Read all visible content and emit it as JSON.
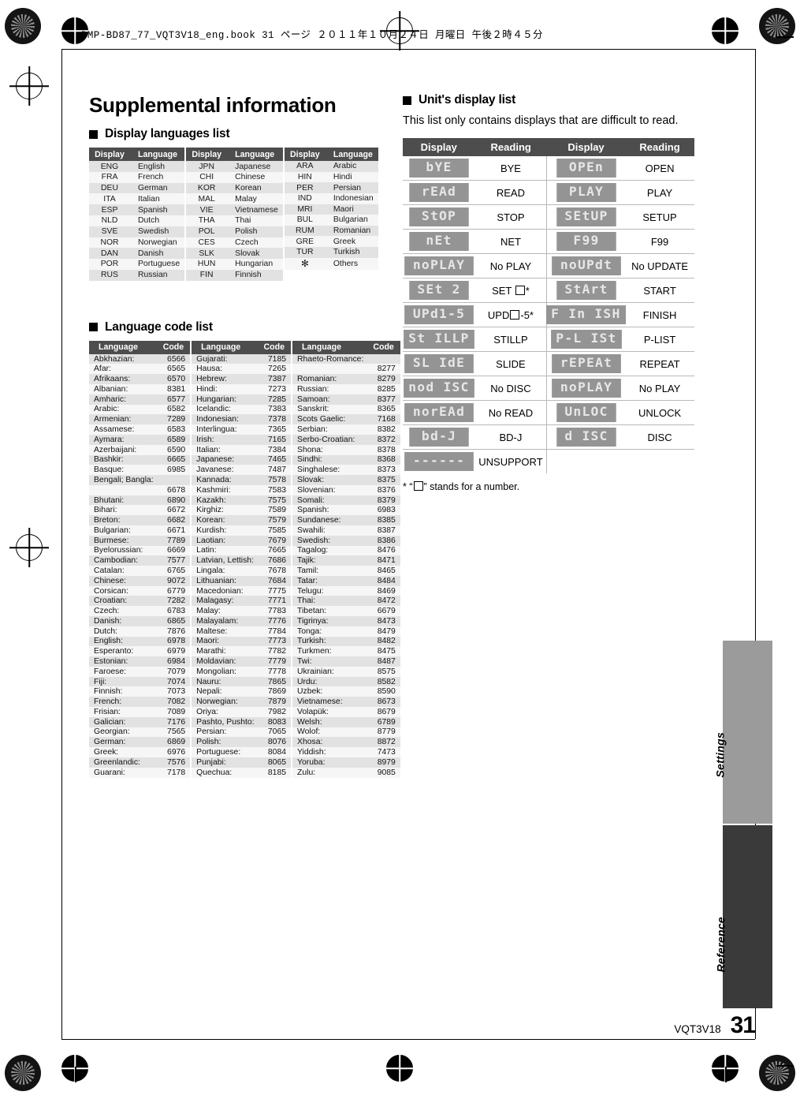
{
  "doc_header": "DMP-BD87_77_VQT3V18_eng.book  31 ページ  ２０１１年１０月２４日  月曜日  午後２時４５分",
  "title": "Supplemental information",
  "sections": {
    "display_languages": "Display languages list",
    "language_code": "Language code list",
    "unit_display": "Unit's display list"
  },
  "unit_display_lead": "This list only contains displays that are difficult to read.",
  "lang_list": {
    "headers": [
      "Display",
      "Language"
    ],
    "blocks": [
      [
        [
          "ENG",
          "English"
        ],
        [
          "FRA",
          "French"
        ],
        [
          "DEU",
          "German"
        ],
        [
          "ITA",
          "Italian"
        ],
        [
          "ESP",
          "Spanish"
        ],
        [
          "NLD",
          "Dutch"
        ],
        [
          "SVE",
          "Swedish"
        ],
        [
          "NOR",
          "Norwegian"
        ],
        [
          "DAN",
          "Danish"
        ],
        [
          "POR",
          "Portuguese"
        ],
        [
          "RUS",
          "Russian"
        ]
      ],
      [
        [
          "JPN",
          "Japanese"
        ],
        [
          "CHI",
          "Chinese"
        ],
        [
          "KOR",
          "Korean"
        ],
        [
          "MAL",
          "Malay"
        ],
        [
          "VIE",
          "Vietnamese"
        ],
        [
          "THA",
          "Thai"
        ],
        [
          "POL",
          "Polish"
        ],
        [
          "CES",
          "Czech"
        ],
        [
          "SLK",
          "Slovak"
        ],
        [
          "HUN",
          "Hungarian"
        ],
        [
          "FIN",
          "Finnish"
        ]
      ],
      [
        [
          "ARA",
          "Arabic"
        ],
        [
          "HIN",
          "Hindi"
        ],
        [
          "PER",
          "Persian"
        ],
        [
          "IND",
          "Indonesian"
        ],
        [
          "MRI",
          "Maori"
        ],
        [
          "BUL",
          "Bulgarian"
        ],
        [
          "RUM",
          "Romanian"
        ],
        [
          "GRE",
          "Greek"
        ],
        [
          "TUR",
          "Turkish"
        ],
        [
          "✻",
          "Others"
        ]
      ]
    ]
  },
  "code_list": {
    "headers": [
      "Language",
      "Code"
    ],
    "columns": [
      [
        [
          "Abkhazian:",
          "6566"
        ],
        [
          "Afar:",
          "6565"
        ],
        [
          "Afrikaans:",
          "6570"
        ],
        [
          "Albanian:",
          "8381"
        ],
        [
          "Amharic:",
          "6577"
        ],
        [
          "Arabic:",
          "6582"
        ],
        [
          "Armenian:",
          "7289"
        ],
        [
          "Assamese:",
          "6583"
        ],
        [
          "Aymara:",
          "6589"
        ],
        [
          "Azerbaijani:",
          "6590"
        ],
        [
          "Bashkir:",
          "6665"
        ],
        [
          "Basque:",
          "6985"
        ],
        [
          "Bengali; Bangla:",
          ""
        ],
        [
          "",
          "6678"
        ],
        [
          "Bhutani:",
          "6890"
        ],
        [
          "Bihari:",
          "6672"
        ],
        [
          "Breton:",
          "6682"
        ],
        [
          "Bulgarian:",
          "6671"
        ],
        [
          "Burmese:",
          "7789"
        ],
        [
          "Byelorussian:",
          "6669"
        ],
        [
          "Cambodian:",
          "7577"
        ],
        [
          "Catalan:",
          "6765"
        ],
        [
          "Chinese:",
          "9072"
        ],
        [
          "Corsican:",
          "6779"
        ],
        [
          "Croatian:",
          "7282"
        ],
        [
          "Czech:",
          "6783"
        ],
        [
          "Danish:",
          "6865"
        ],
        [
          "Dutch:",
          "7876"
        ],
        [
          "English:",
          "6978"
        ],
        [
          "Esperanto:",
          "6979"
        ],
        [
          "Estonian:",
          "6984"
        ],
        [
          "Faroese:",
          "7079"
        ],
        [
          "Fiji:",
          "7074"
        ],
        [
          "Finnish:",
          "7073"
        ],
        [
          "French:",
          "7082"
        ],
        [
          "Frisian:",
          "7089"
        ],
        [
          "Galician:",
          "7176"
        ],
        [
          "Georgian:",
          "7565"
        ],
        [
          "German:",
          "6869"
        ],
        [
          "Greek:",
          "6976"
        ],
        [
          "Greenlandic:",
          "7576"
        ],
        [
          "Guarani:",
          "7178"
        ]
      ],
      [
        [
          "Gujarati:",
          "7185"
        ],
        [
          "Hausa:",
          "7265"
        ],
        [
          "Hebrew:",
          "7387"
        ],
        [
          "Hindi:",
          "7273"
        ],
        [
          "Hungarian:",
          "7285"
        ],
        [
          "Icelandic:",
          "7383"
        ],
        [
          "Indonesian:",
          "7378"
        ],
        [
          "Interlingua:",
          "7365"
        ],
        [
          "Irish:",
          "7165"
        ],
        [
          "Italian:",
          "7384"
        ],
        [
          "Japanese:",
          "7465"
        ],
        [
          "Javanese:",
          "7487"
        ],
        [
          "Kannada:",
          "7578"
        ],
        [
          "Kashmiri:",
          "7583"
        ],
        [
          "Kazakh:",
          "7575"
        ],
        [
          "Kirghiz:",
          "7589"
        ],
        [
          "Korean:",
          "7579"
        ],
        [
          "Kurdish:",
          "7585"
        ],
        [
          "Laotian:",
          "7679"
        ],
        [
          "Latin:",
          "7665"
        ],
        [
          "Latvian, Lettish:",
          "7686"
        ],
        [
          "Lingala:",
          "7678"
        ],
        [
          "Lithuanian:",
          "7684"
        ],
        [
          "Macedonian:",
          "7775"
        ],
        [
          "Malagasy:",
          "7771"
        ],
        [
          "Malay:",
          "7783"
        ],
        [
          "Malayalam:",
          "7776"
        ],
        [
          "Maltese:",
          "7784"
        ],
        [
          "Maori:",
          "7773"
        ],
        [
          "Marathi:",
          "7782"
        ],
        [
          "Moldavian:",
          "7779"
        ],
        [
          "Mongolian:",
          "7778"
        ],
        [
          "Nauru:",
          "7865"
        ],
        [
          "Nepali:",
          "7869"
        ],
        [
          "Norwegian:",
          "7879"
        ],
        [
          "Oriya:",
          "7982"
        ],
        [
          "Pashto, Pushto:",
          "8083"
        ],
        [
          "Persian:",
          "7065"
        ],
        [
          "Polish:",
          "8076"
        ],
        [
          "Portuguese:",
          "8084"
        ],
        [
          "Punjabi:",
          "8065"
        ],
        [
          "Quechua:",
          "8185"
        ]
      ],
      [
        [
          "Rhaeto-Romance:",
          ""
        ],
        [
          "",
          "8277"
        ],
        [
          "Romanian:",
          "8279"
        ],
        [
          "Russian:",
          "8285"
        ],
        [
          "Samoan:",
          "8377"
        ],
        [
          "Sanskrit:",
          "8365"
        ],
        [
          "Scots Gaelic:",
          "7168"
        ],
        [
          "Serbian:",
          "8382"
        ],
        [
          "Serbo-Croatian:",
          "8372"
        ],
        [
          "Shona:",
          "8378"
        ],
        [
          "Sindhi:",
          "8368"
        ],
        [
          "Singhalese:",
          "8373"
        ],
        [
          "Slovak:",
          "8375"
        ],
        [
          "Slovenian:",
          "8376"
        ],
        [
          "Somali:",
          "8379"
        ],
        [
          "Spanish:",
          "6983"
        ],
        [
          "Sundanese:",
          "8385"
        ],
        [
          "Swahili:",
          "8387"
        ],
        [
          "Swedish:",
          "8386"
        ],
        [
          "Tagalog:",
          "8476"
        ],
        [
          "Tajik:",
          "8471"
        ],
        [
          "Tamil:",
          "8465"
        ],
        [
          "Tatar:",
          "8484"
        ],
        [
          "Telugu:",
          "8469"
        ],
        [
          "Thai:",
          "8472"
        ],
        [
          "Tibetan:",
          "6679"
        ],
        [
          "Tigrinya:",
          "8473"
        ],
        [
          "Tonga:",
          "8479"
        ],
        [
          "Turkish:",
          "8482"
        ],
        [
          "Turkmen:",
          "8475"
        ],
        [
          "Twi:",
          "8487"
        ],
        [
          "Ukrainian:",
          "8575"
        ],
        [
          "Urdu:",
          "8582"
        ],
        [
          "Uzbek:",
          "8590"
        ],
        [
          "Vietnamese:",
          "8673"
        ],
        [
          "Volapük:",
          "8679"
        ],
        [
          "Welsh:",
          "6789"
        ],
        [
          "Wolof:",
          "8779"
        ],
        [
          "Xhosa:",
          "8872"
        ],
        [
          "Yiddish:",
          "7473"
        ],
        [
          "Yoruba:",
          "8979"
        ],
        [
          "Zulu:",
          "9085"
        ]
      ]
    ]
  },
  "unit_display": {
    "headers": [
      "Display",
      "Reading",
      "Display",
      "Reading"
    ],
    "rows": [
      {
        "left_seg": "bYE",
        "left_read": "BYE",
        "right_seg": "OPEn",
        "right_read": "OPEN"
      },
      {
        "left_seg": "rEAd",
        "left_read": "READ",
        "right_seg": "PLAY",
        "right_read": "PLAY"
      },
      {
        "left_seg": "StOP",
        "left_read": "STOP",
        "right_seg": "SEtUP",
        "right_read": "SETUP"
      },
      {
        "left_seg": "nEt",
        "left_read": "NET",
        "right_seg": "F99",
        "right_read": "F99"
      },
      {
        "left_seg": "noPLAY",
        "left_read": "No PLAY",
        "right_seg": "noUPdt",
        "right_read": "No UPDATE"
      },
      {
        "left_seg": "SEt 2",
        "left_read": "SET □*",
        "right_seg": "StArt",
        "right_read": "START"
      },
      {
        "left_seg": "UPd1-5",
        "left_read": "UPD□-5*",
        "right_seg": "F In ISH",
        "right_read": "FINISH"
      },
      {
        "left_seg": "St ILLP",
        "left_read": "STILLP",
        "right_seg": "P-L ISt",
        "right_read": "P-LIST"
      },
      {
        "left_seg": "SL IdE",
        "left_read": "SLIDE",
        "right_seg": "rEPEAt",
        "right_read": "REPEAT"
      },
      {
        "left_seg": "nod ISC",
        "left_read": "No DISC",
        "right_seg": "noPLAY",
        "right_read": "No PLAY"
      },
      {
        "left_seg": "norEAd",
        "left_read": "No READ",
        "right_seg": "UnLOC",
        "right_read": "UNLOCK"
      },
      {
        "left_seg": "bd-J",
        "left_read": "BD-J",
        "right_seg": "d ISC",
        "right_read": "DISC"
      },
      {
        "left_seg": "------",
        "left_read": "UNSUPPORT",
        "right_seg": "",
        "right_read": ""
      }
    ]
  },
  "footnote_pre": "* “",
  "footnote_post": "” stands for a number.",
  "side_tabs": [
    {
      "label": "Settings",
      "color": "#9b9b9b"
    },
    {
      "label": "Reference",
      "color": "#3a3a3a"
    }
  ],
  "footer": {
    "doc_code": "VQT3V18",
    "page_number": "31"
  }
}
